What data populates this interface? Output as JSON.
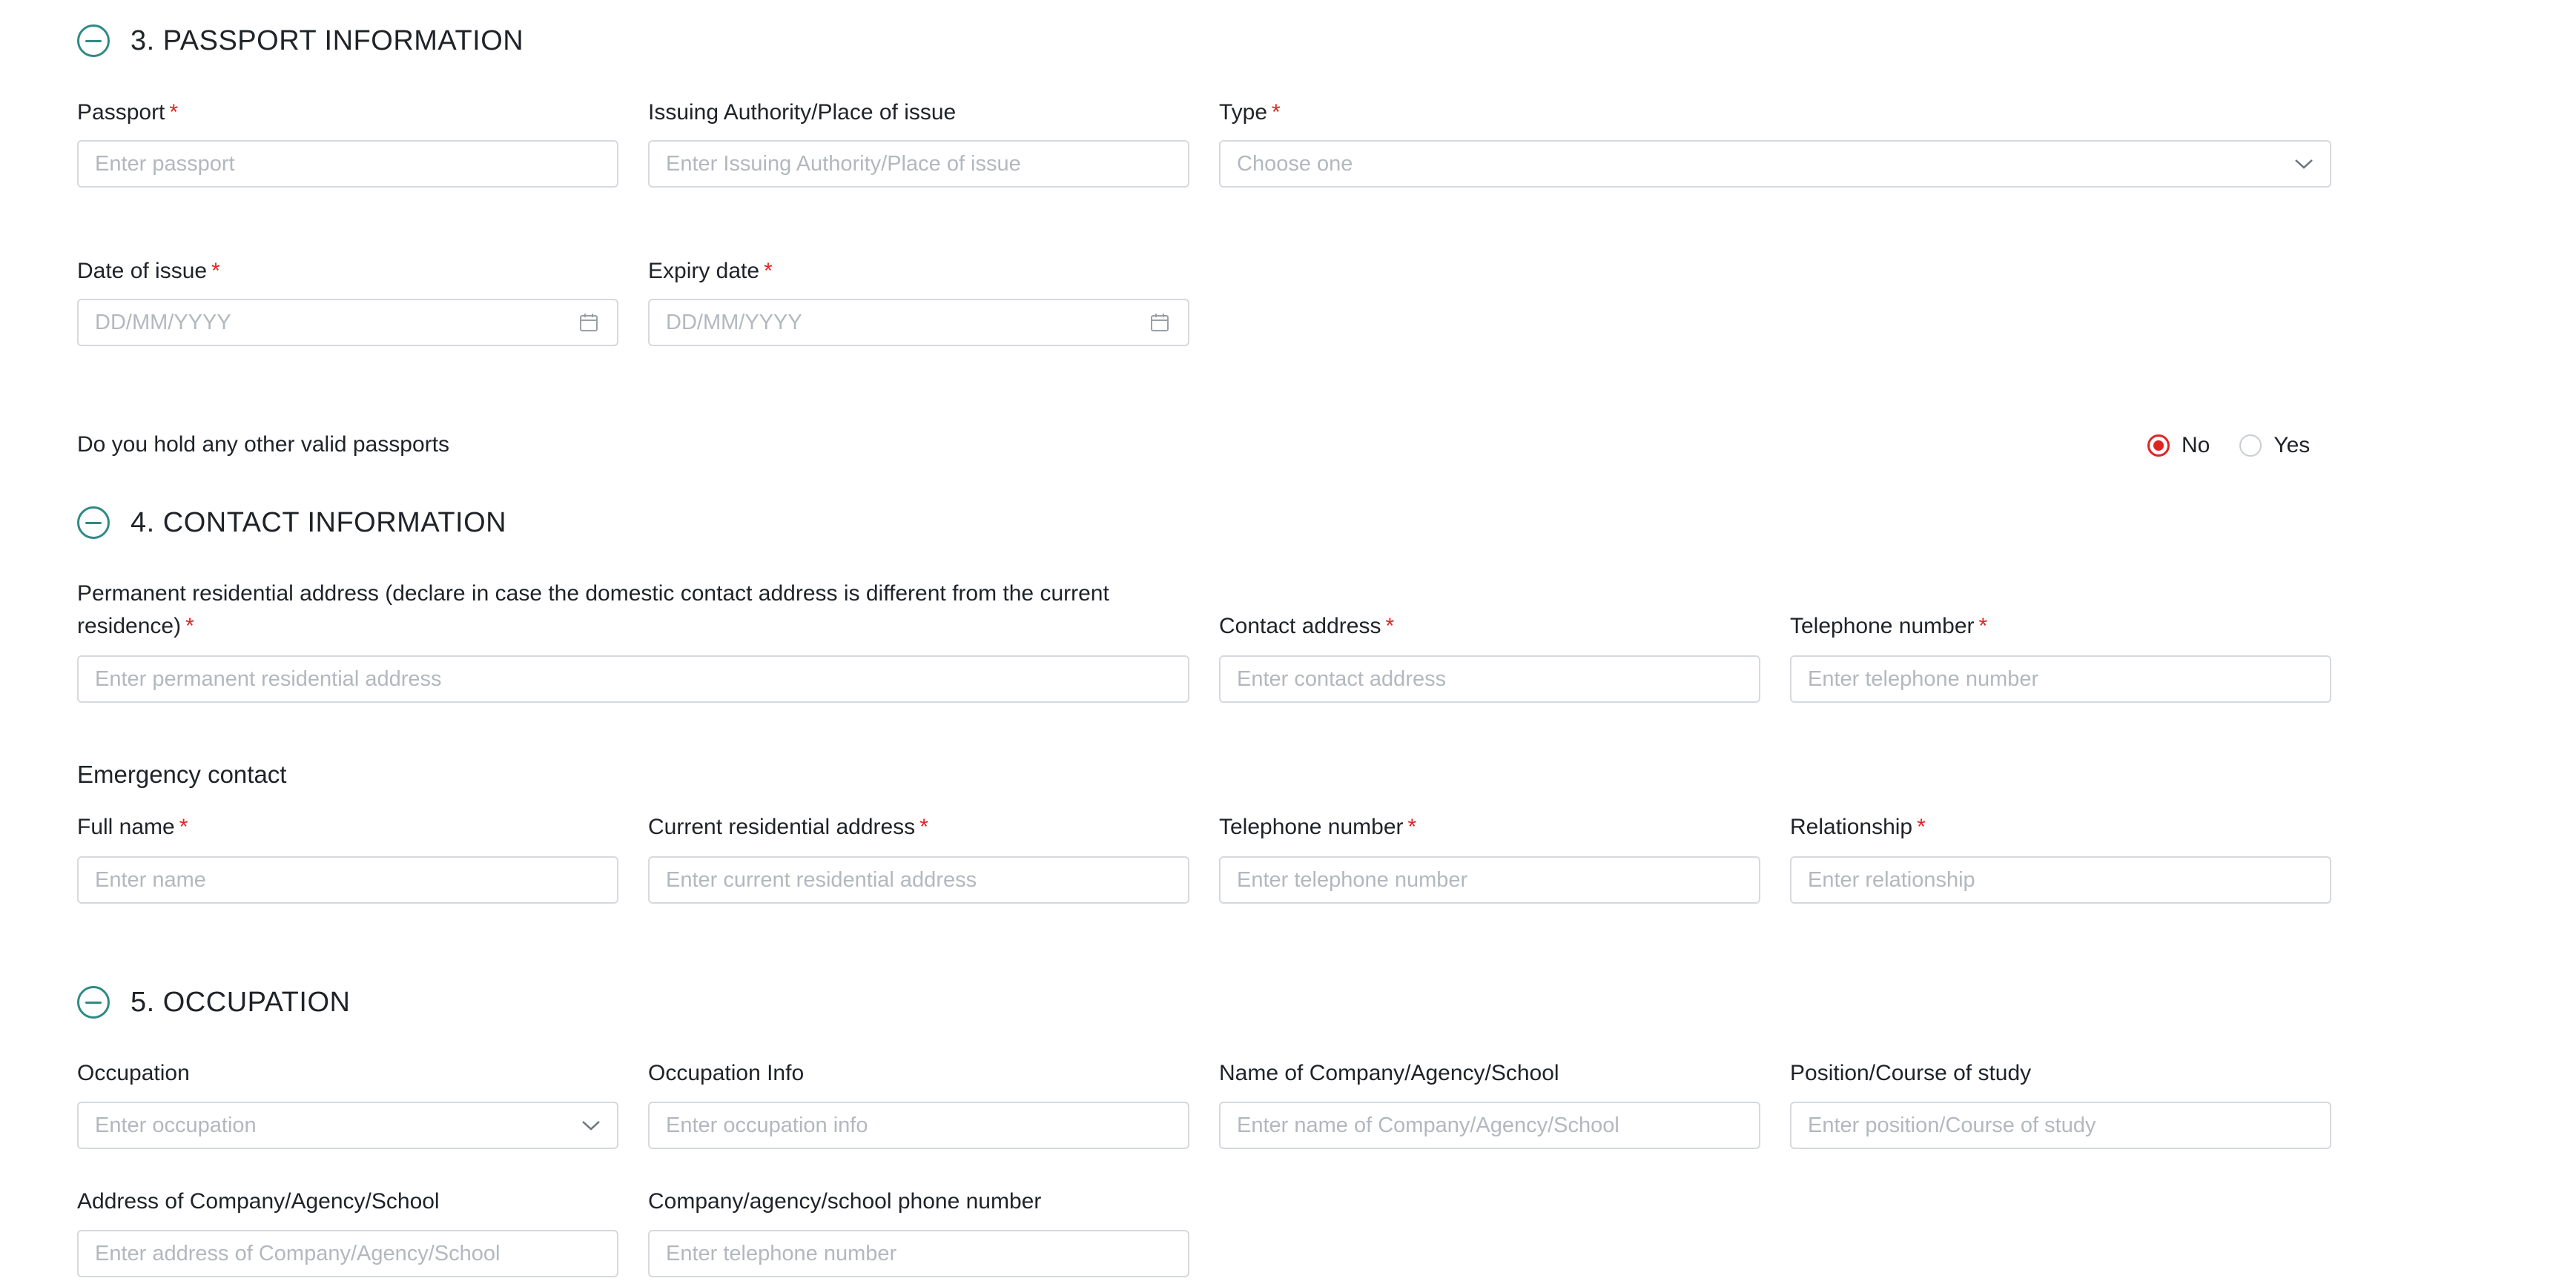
{
  "sections": {
    "passport": {
      "title": "3. PASSPORT INFORMATION",
      "passport_label": "Passport",
      "passport_placeholder": "Enter passport",
      "authority_label": "Issuing Authority/Place of issue",
      "authority_placeholder": "Enter Issuing Authority/Place of issue",
      "type_label": "Type",
      "type_placeholder": "Choose one",
      "issue_label": "Date of issue",
      "issue_placeholder": "DD/MM/YYYY",
      "expiry_label": "Expiry date",
      "expiry_placeholder": "DD/MM/YYYY",
      "other_passports_question": "Do you hold any other valid passports",
      "option_no": "No",
      "option_yes": "Yes",
      "selected": "No"
    },
    "contact": {
      "title": "4. CONTACT INFORMATION",
      "permanent_label_line1": "Permanent residential address (declare in case the domestic contact address is different from the current",
      "permanent_label_line2": "residence)",
      "permanent_placeholder": "Enter permanent residential address",
      "contact_label": "Contact address",
      "contact_placeholder": "Enter contact address",
      "phone_label": "Telephone number",
      "phone_placeholder": "Enter telephone number",
      "emergency_heading": "Emergency contact",
      "e_name_label": "Full name",
      "e_name_placeholder": "Enter name",
      "e_address_label": "Current residential address",
      "e_address_placeholder": "Enter current residential address",
      "e_phone_label": "Telephone number",
      "e_phone_placeholder": "Enter telephone number",
      "e_relationship_label": "Relationship",
      "e_relationship_placeholder": "Enter relationship"
    },
    "occupation": {
      "title": "5. OCCUPATION",
      "occupation_label": "Occupation",
      "occupation_placeholder": "Enter occupation",
      "info_label": "Occupation Info",
      "info_placeholder": "Enter occupation info",
      "company_label": "Name of Company/Agency/School",
      "company_placeholder": "Enter name of Company/Agency/School",
      "position_label": "Position/Course of study",
      "position_placeholder": "Enter position/Course of study",
      "address_label": "Address of Company/Agency/School",
      "address_placeholder": "Enter address of Company/Agency/School",
      "company_phone_label": "Company/agency/school phone number",
      "company_phone_placeholder": "Enter telephone number"
    }
  },
  "required_mark": "*",
  "colors": {
    "accent": "#2f8a85",
    "required": "#e02424",
    "border": "#d6d9dd",
    "placeholder": "#b3b8bf"
  }
}
